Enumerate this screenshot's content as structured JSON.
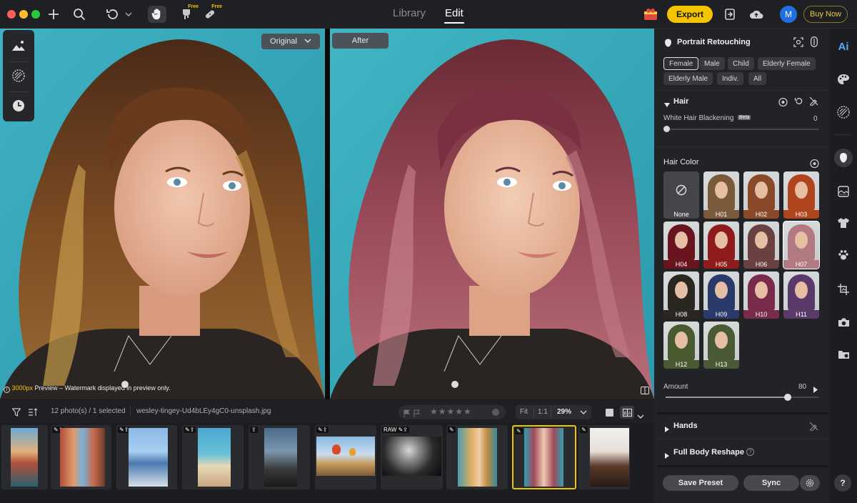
{
  "topbar": {
    "tabs": [
      {
        "label": "Library"
      },
      {
        "label": "Edit"
      }
    ],
    "free_label": "Free",
    "export_label": "Export",
    "buy_now_label": "Buy Now",
    "avatar_initial": "M"
  },
  "canvas": {
    "original_label": "Original",
    "after_label": "After",
    "watermark": {
      "size": "3000px",
      "text": " Preview – Watermark displayed in preview only."
    }
  },
  "filmstrip": {
    "count_text": "12 photo(s) / 1 selected",
    "filename": "wesley-tingey-Ud4bLEy4gC0-unsplash.jpg",
    "zoom": {
      "fit": "Fit",
      "one": "1:1",
      "value": "29%"
    },
    "raw_label": "RAW"
  },
  "panel": {
    "title": "Portrait Retouching",
    "chips_row1": [
      "Female",
      "Male",
      "Child",
      "Elderly Female"
    ],
    "chips_row2": [
      "Elderly Male",
      "Indiv.",
      "All"
    ],
    "hair": {
      "title": "Hair",
      "white_hair_label": "White Hair Blackening",
      "beta": "Beta",
      "white_hair_value": "0"
    },
    "hair_color": {
      "title": "Hair Color",
      "swatches": [
        {
          "label": "None",
          "color": "#555555"
        },
        {
          "label": "H01",
          "color": "#7a5a3a"
        },
        {
          "label": "H02",
          "color": "#8a4a2a"
        },
        {
          "label": "H03",
          "color": "#b0441c"
        },
        {
          "label": "H04",
          "color": "#6a1420"
        },
        {
          "label": "H05",
          "color": "#8e1c1c"
        },
        {
          "label": "H06",
          "color": "#6a4040"
        },
        {
          "label": "H07",
          "color": "#b07a80"
        },
        {
          "label": "H08",
          "color": "#2a2620"
        },
        {
          "label": "H09",
          "color": "#2a3a6a"
        },
        {
          "label": "H10",
          "color": "#7a2a4a"
        },
        {
          "label": "H11",
          "color": "#5a3a6a"
        },
        {
          "label": "H12",
          "color": "#4a5a30"
        },
        {
          "label": "H13",
          "color": "#4a5a36"
        }
      ],
      "selected": "H07"
    },
    "amount": {
      "label": "Amount",
      "value": "80",
      "fraction": 0.8
    },
    "hands_title": "Hands",
    "full_body_title": "Full Body Reshape",
    "save_preset": "Save Preset",
    "sync": "Sync"
  },
  "rail": {
    "ai_label": "Ai"
  },
  "help": "?"
}
